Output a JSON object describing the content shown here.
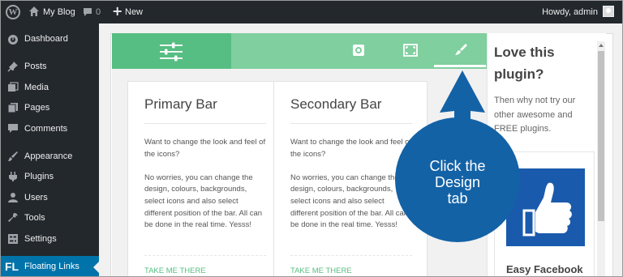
{
  "adminbar": {
    "site_name": "My Blog",
    "comment_count": "0",
    "new_label": "New",
    "greeting": "Howdy, admin"
  },
  "sidebar": {
    "items": [
      {
        "label": "Dashboard",
        "icon": "dashboard-icon"
      },
      {
        "label": "Posts",
        "icon": "pushpin-icon"
      },
      {
        "label": "Media",
        "icon": "media-icon"
      },
      {
        "label": "Pages",
        "icon": "pages-icon"
      },
      {
        "label": "Comments",
        "icon": "comment-icon"
      },
      {
        "label": "Appearance",
        "icon": "brush-icon"
      },
      {
        "label": "Plugins",
        "icon": "plugin-icon"
      },
      {
        "label": "Users",
        "icon": "users-icon"
      },
      {
        "label": "Tools",
        "icon": "wrench-icon"
      },
      {
        "label": "Settings",
        "icon": "settings-icon"
      }
    ],
    "active": {
      "badge": "FL",
      "label": "Floating Links"
    }
  },
  "tabs": [
    {
      "name": "layout",
      "icon": "sliders-icon"
    },
    {
      "name": "settings",
      "icon": "gear-icon"
    },
    {
      "name": "position",
      "icon": "expand-icon"
    },
    {
      "name": "design",
      "icon": "paintbrush-icon"
    }
  ],
  "cards": [
    {
      "title": "Primary Bar",
      "paragraph1": "Want to change the look and feel of the icons?",
      "paragraph2": "No worries, you can change the design, colours, backgrounds, select icons and also select different position of the bar. All can be done in the real time. Yesss!",
      "link": "TAKE ME THERE"
    },
    {
      "title": "Secondary Bar",
      "paragraph1": "Want to change the look and feel of the icons?",
      "paragraph2": "No worries, you can change the design, colours, backgrounds, select icons and also select different position of the bar. All can be done in the real time. Yesss!",
      "link": "TAKE ME THERE"
    }
  ],
  "promo": {
    "title": "Love this plugin?",
    "text": "Then why not try our other awesome and FREE plugins.",
    "plugin_title": "Easy Facebook"
  },
  "callout": {
    "line1": "Click the",
    "line2": "Design",
    "line3": "tab"
  },
  "colors": {
    "admin_dark": "#23282d",
    "accent_blue": "#0073aa",
    "tab_green": "#56be82",
    "tab_green_light": "#7fcf9f",
    "callout_blue": "#1462a6"
  }
}
